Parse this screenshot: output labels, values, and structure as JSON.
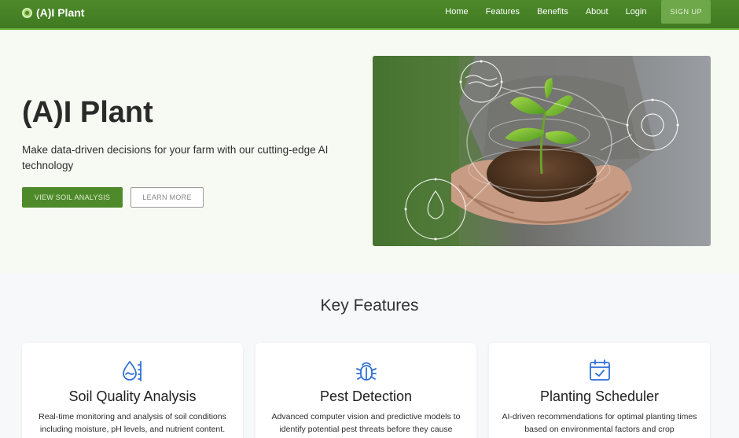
{
  "nav": {
    "brand": "(A)I Plant",
    "links": [
      "Home",
      "Features",
      "Benefits",
      "About",
      "Login"
    ],
    "signup": "SIGN UP",
    "colors": {
      "primary": "#4e8a2a",
      "accent": "#6fb33b"
    }
  },
  "hero": {
    "title": "(A)I Plant",
    "subtitle": "Make data-driven decisions for your farm with our cutting-edge AI technology",
    "primary_button": "VIEW SOIL ANALYSIS",
    "secondary_button": "LEARN MORE"
  },
  "features": {
    "title": "Key Features",
    "items": [
      {
        "icon": "water-drop-sensor-icon",
        "title": "Soil Quality Analysis",
        "desc": "Real-time monitoring and analysis of soil conditions including moisture, pH levels, and nutrient content."
      },
      {
        "icon": "bug-icon",
        "title": "Pest Detection",
        "desc": "Advanced computer vision and predictive models to identify potential pest threats before they cause"
      },
      {
        "icon": "calendar-check-icon",
        "title": "Planting Scheduler",
        "desc": "AI-driven recommendations for optimal planting times based on environmental factors and crop"
      }
    ]
  }
}
